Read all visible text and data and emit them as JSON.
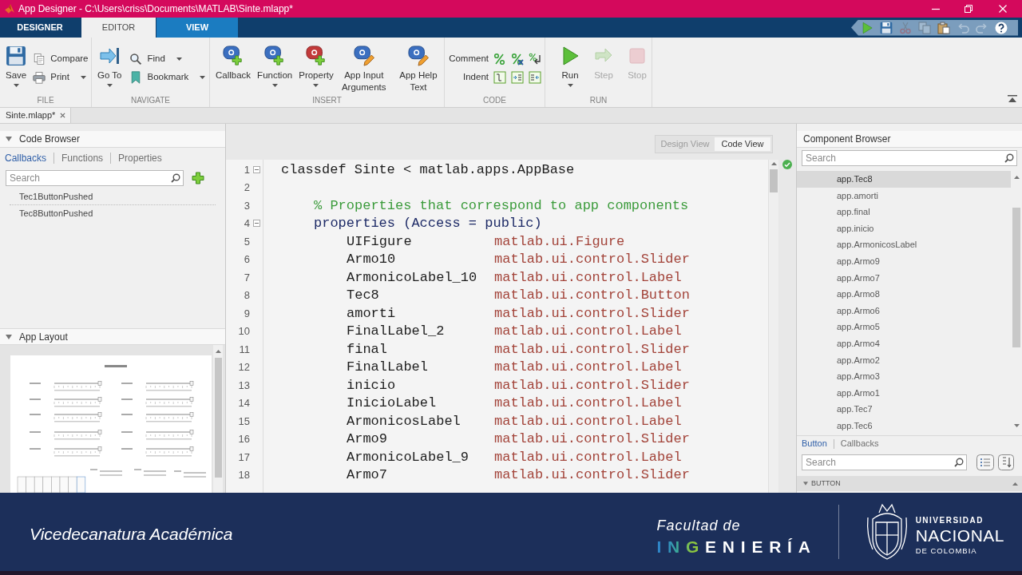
{
  "window": {
    "title": "App Designer - C:\\Users\\criss\\Documents\\MATLAB\\Sinte.mlapp*"
  },
  "tabs": [
    {
      "label": "DESIGNER",
      "selected": false,
      "hovered": false
    },
    {
      "label": "EDITOR",
      "selected": true,
      "hovered": false
    },
    {
      "label": "VIEW",
      "selected": false,
      "hovered": true
    }
  ],
  "quick_access": [
    {
      "kind": "run",
      "disabled": false
    },
    {
      "kind": "save",
      "disabled": false
    },
    {
      "kind": "cut",
      "disabled": true
    },
    {
      "kind": "copy",
      "disabled": true
    },
    {
      "kind": "paste",
      "disabled": false
    },
    {
      "kind": "undo",
      "disabled": true
    },
    {
      "kind": "redo",
      "disabled": true
    },
    {
      "kind": "help",
      "disabled": false
    }
  ],
  "ribbon": {
    "groups": [
      {
        "label": "FILE",
        "large": [
          {
            "kind": "save",
            "label": "Save",
            "dropdown": true
          }
        ],
        "small": [
          {
            "kind": "compare",
            "label": "Compare",
            "dropdown": false
          },
          {
            "kind": "print",
            "label": "Print",
            "dropdown": true
          }
        ]
      },
      {
        "label": "NAVIGATE",
        "large": [
          {
            "kind": "go-to",
            "label": "Go To",
            "dropdown": true
          }
        ],
        "small": [
          {
            "kind": "find",
            "label": "Find",
            "dropdown": true
          },
          {
            "kind": "bookmark",
            "label": "Bookmark",
            "dropdown": true
          }
        ]
      },
      {
        "label": "INSERT",
        "large": [
          {
            "kind": "callback",
            "label": "Callback",
            "dropdown": false
          },
          {
            "kind": "function",
            "label": "Function",
            "dropdown": true
          },
          {
            "kind": "property",
            "label": "Property",
            "dropdown": true
          },
          {
            "kind": "input-arguments",
            "label": "App Input Arguments",
            "dropdown": false
          },
          {
            "kind": "help-text",
            "label": "App Help Text",
            "dropdown": false
          }
        ]
      },
      {
        "label": "CODE",
        "rows": [
          {
            "label": "Comment",
            "tools": [
              {
                "kind": "comment"
              },
              {
                "kind": "uncomment"
              },
              {
                "kind": "wrap-comments"
              }
            ]
          },
          {
            "label": "Indent",
            "tools": [
              {
                "kind": "smart-indent"
              },
              {
                "kind": "increase-indent"
              },
              {
                "kind": "decrease-indent"
              }
            ]
          }
        ]
      },
      {
        "label": "RUN",
        "large": [
          {
            "kind": "run",
            "label": "Run",
            "dropdown": true,
            "disabled": false
          },
          {
            "kind": "step",
            "label": "Step",
            "dropdown": false,
            "disabled": true
          },
          {
            "kind": "stop",
            "label": "Stop",
            "dropdown": false,
            "disabled": true
          }
        ]
      }
    ]
  },
  "document_tabs": [
    {
      "label": "Sinte.mlapp*",
      "selected": true
    }
  ],
  "code_browser": {
    "title": "Code Browser",
    "expanded": true,
    "tabs": [
      {
        "label": "Callbacks",
        "selected": true
      },
      {
        "label": "Functions",
        "selected": false
      },
      {
        "label": "Properties",
        "selected": false
      }
    ],
    "search": {
      "placeholder": "Search"
    },
    "items": [
      "Tec1ButtonPushed",
      "Tec8ButtonPushed"
    ]
  },
  "app_layout": {
    "title": "App Layout",
    "expanded": true
  },
  "view_toggle": [
    {
      "label": "Design View",
      "selected": false
    },
    {
      "label": "Code View",
      "selected": true
    }
  ],
  "editor": {
    "lines": [
      {
        "number": "1",
        "kind": "classdef",
        "text": "classdef Sinte < matlab.apps.AppBase"
      },
      {
        "number": "2",
        "kind": "blank"
      },
      {
        "number": "3",
        "kind": "comment",
        "text": "% Properties that correspond to app components"
      },
      {
        "number": "4",
        "kind": "block",
        "text": "properties (Access = public)"
      },
      {
        "number": "5",
        "kind": "property",
        "name": "UIFigure",
        "type": "matlab.ui.Figure"
      },
      {
        "number": "6",
        "kind": "property",
        "name": "Armo10",
        "type": "matlab.ui.control.Slider"
      },
      {
        "number": "7",
        "kind": "property",
        "name": "ArmonicoLabel_10",
        "type": "matlab.ui.control.Label"
      },
      {
        "number": "8",
        "kind": "property",
        "name": "Tec8",
        "type": "matlab.ui.control.Button"
      },
      {
        "number": "9",
        "kind": "property",
        "name": "amorti",
        "type": "matlab.ui.control.Slider"
      },
      {
        "number": "10",
        "kind": "property",
        "name": "FinalLabel_2",
        "type": "matlab.ui.control.Label"
      },
      {
        "number": "11",
        "kind": "property",
        "name": "final",
        "type": "matlab.ui.control.Slider"
      },
      {
        "number": "12",
        "kind": "property",
        "name": "FinalLabel",
        "type": "matlab.ui.control.Label"
      },
      {
        "number": "13",
        "kind": "property",
        "name": "inicio",
        "type": "matlab.ui.control.Slider"
      },
      {
        "number": "14",
        "kind": "property",
        "name": "InicioLabel",
        "type": "matlab.ui.control.Label"
      },
      {
        "number": "15",
        "kind": "property",
        "name": "ArmonicosLabel",
        "type": "matlab.ui.control.Label"
      },
      {
        "number": "16",
        "kind": "property",
        "name": "Armo9",
        "type": "matlab.ui.control.Slider"
      },
      {
        "number": "17",
        "kind": "property",
        "name": "ArmonicoLabel_9",
        "type": "matlab.ui.control.Label"
      },
      {
        "number": "18",
        "kind": "property",
        "name": "Armo7",
        "type": "matlab.ui.control.Slider"
      }
    ]
  },
  "component_browser": {
    "title": "Component Browser",
    "search": {
      "placeholder": "Search"
    },
    "items": [
      {
        "label": "app.Tec8",
        "selected": true
      },
      {
        "label": "app.amorti",
        "selected": false
      },
      {
        "label": "app.final",
        "selected": false
      },
      {
        "label": "app.inicio",
        "selected": false
      },
      {
        "label": "app.ArmonicosLabel",
        "selected": false
      },
      {
        "label": "app.Armo9",
        "selected": false
      },
      {
        "label": "app.Armo7",
        "selected": false
      },
      {
        "label": "app.Armo8",
        "selected": false
      },
      {
        "label": "app.Armo6",
        "selected": false
      },
      {
        "label": "app.Armo5",
        "selected": false
      },
      {
        "label": "app.Armo4",
        "selected": false
      },
      {
        "label": "app.Armo2",
        "selected": false
      },
      {
        "label": "app.Armo3",
        "selected": false
      },
      {
        "label": "app.Armo1",
        "selected": false
      },
      {
        "label": "app.Tec7",
        "selected": false
      },
      {
        "label": "app.Tec6",
        "selected": false
      }
    ],
    "inspector_tabs": [
      {
        "label": "Button",
        "selected": true
      },
      {
        "label": "Callbacks",
        "selected": false
      }
    ],
    "inspector_search": {
      "placeholder": "Search"
    },
    "section": {
      "label": "BUTTON",
      "expanded": true
    }
  },
  "banner": {
    "caption": "Vicedecanatura Académica",
    "faculty_prefix": "Facultad de",
    "faculty_wordmark": "INGENIERÍA",
    "university": [
      "UNIVERSIDAD",
      "NACIONAL",
      "DE COLOMBIA"
    ]
  }
}
